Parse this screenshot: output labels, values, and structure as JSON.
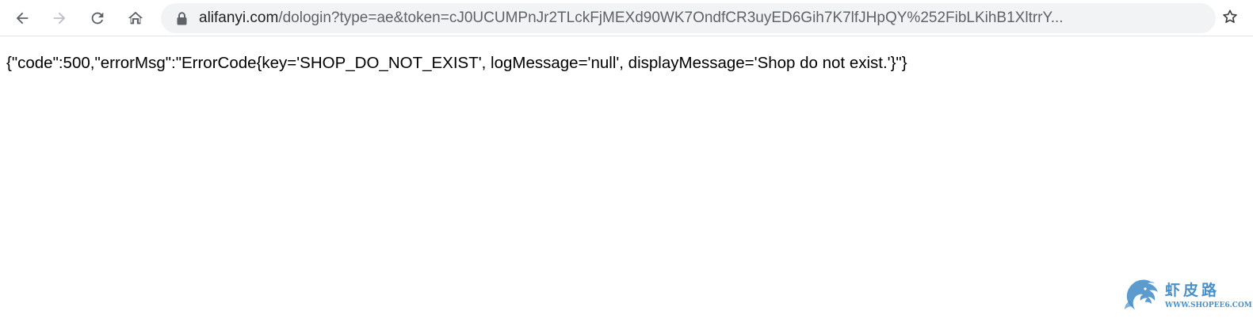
{
  "browser": {
    "url_host": "alifanyi.com",
    "url_rest": "/dologin?type=ae&token=cJ0UCUMPnJr2TLckFjMEXd90WK7OndfCR3uyED6Gih7K7lfJHpQY%252FibLKihB1XltrrY...",
    "icons": {
      "back": "arrow-left-icon",
      "forward": "arrow-right-icon",
      "reload": "reload-icon",
      "home": "home-icon",
      "lock": "lock-icon",
      "bookmark": "star-icon"
    }
  },
  "page": {
    "response_text": "{\"code\":500,\"errorMsg\":\"ErrorCode{key='SHOP_DO_NOT_EXIST', logMessage='null', displayMessage='Shop do not exist.'}\"}"
  },
  "watermark": {
    "title": "虾皮路",
    "url": "WWW.SHOPEE6.COM",
    "color": "#4a90c8"
  }
}
